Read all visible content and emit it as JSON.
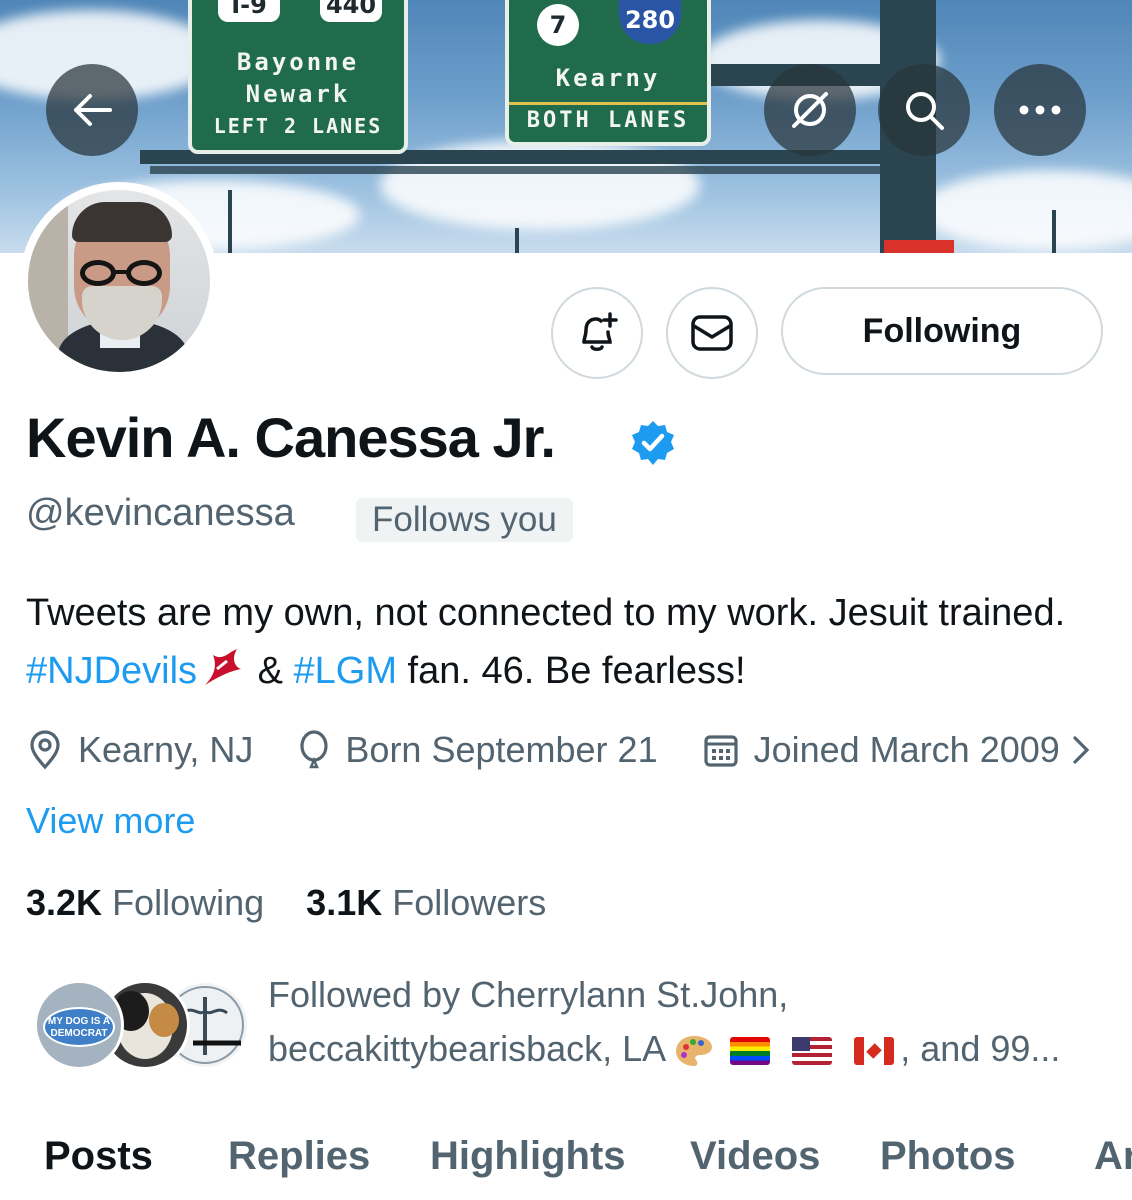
{
  "banner": {
    "sign_left": {
      "route_left": "I-9",
      "route_right": "440",
      "line1": "Bayonne",
      "line2": "Newark",
      "line3": "LEFT 2 LANES"
    },
    "sign_right": {
      "route_left": "7",
      "route_right": "280",
      "line1": "Kearny",
      "line2": "BOTH LANES"
    }
  },
  "header": {
    "back_icon": "arrow-left-icon",
    "grok_icon": "grok-icon",
    "search_icon": "search-icon",
    "more_icon": "more-dots-icon"
  },
  "actions": {
    "notify_icon": "bell-plus-icon",
    "message_icon": "mail-icon",
    "following_label": "Following"
  },
  "profile": {
    "name": "Kevin A. Canessa Jr.",
    "handle": "@kevincanessa",
    "follows_you": "Follows you",
    "bio_part1": "Tweets are my own, not connected to my work. Jesuit trained. ",
    "bio_tag1": "#NJDevils",
    "bio_part2": " & ",
    "bio_tag2": "#LGM",
    "bio_part3": " fan. 46. Be fearless!",
    "location": "Kearny, NJ",
    "birthday": "Born September 21",
    "joined": "Joined March 2009",
    "view_more": "View more"
  },
  "stats": {
    "following_count": "3.2K",
    "following_label": "Following",
    "followers_count": "3.1K",
    "followers_label": "Followers"
  },
  "followed_by": {
    "line1": "Followed by Cherrylann St.John,",
    "line2a": "beccakittybearisback, LA",
    "line2b": ", and 99...",
    "avatar1_text": "MY DOG IS A DEMOCRAT"
  },
  "tabs": [
    "Posts",
    "Replies",
    "Highlights",
    "Videos",
    "Photos",
    "Ar"
  ],
  "colors": {
    "accent": "#1d9bf0",
    "text": "#0f1419",
    "muted": "#536471",
    "border": "#cfd9de"
  }
}
